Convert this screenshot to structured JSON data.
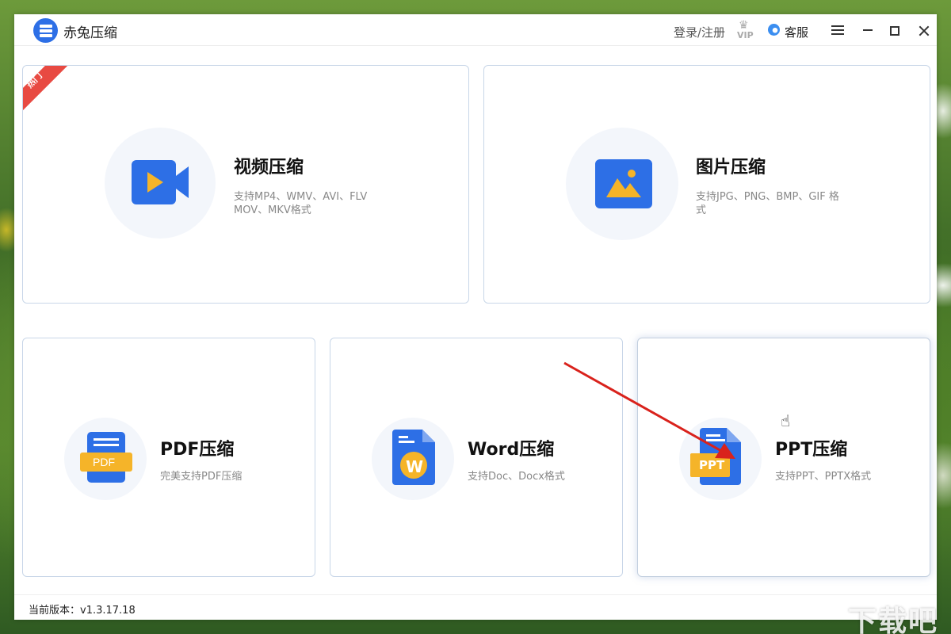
{
  "window": {
    "title": "赤兔压缩",
    "login_label": "登录/注册",
    "vip_label": "VIP",
    "service_label": "客服"
  },
  "cards": {
    "video": {
      "title": "视频压缩",
      "desc_line1": "支持MP4、WMV、AVI、FLV",
      "desc_line2": "MOV、MKV格式",
      "badge": "热门"
    },
    "image": {
      "title": "图片压缩",
      "desc_line1": "支持JPG、PNG、BMP、GIF 格",
      "desc_line2": "式"
    },
    "pdf": {
      "title": "PDF压缩",
      "desc": "完美支持PDF压缩",
      "icon_label": "PDF"
    },
    "word": {
      "title": "Word压缩",
      "desc": "支持Doc、Docx格式",
      "icon_label": "W"
    },
    "ppt": {
      "title": "PPT压缩",
      "desc": "支持PPT、PPTX格式",
      "icon_label": "PPT"
    }
  },
  "footer": {
    "version": "当前版本：v1.3.17.18"
  },
  "watermark": "下载吧",
  "colors": {
    "brand_blue": "#2d6fe6",
    "hot_red": "#e84a42",
    "accent_yellow": "#f5b429",
    "annotation_arrow": "#d9221c"
  }
}
